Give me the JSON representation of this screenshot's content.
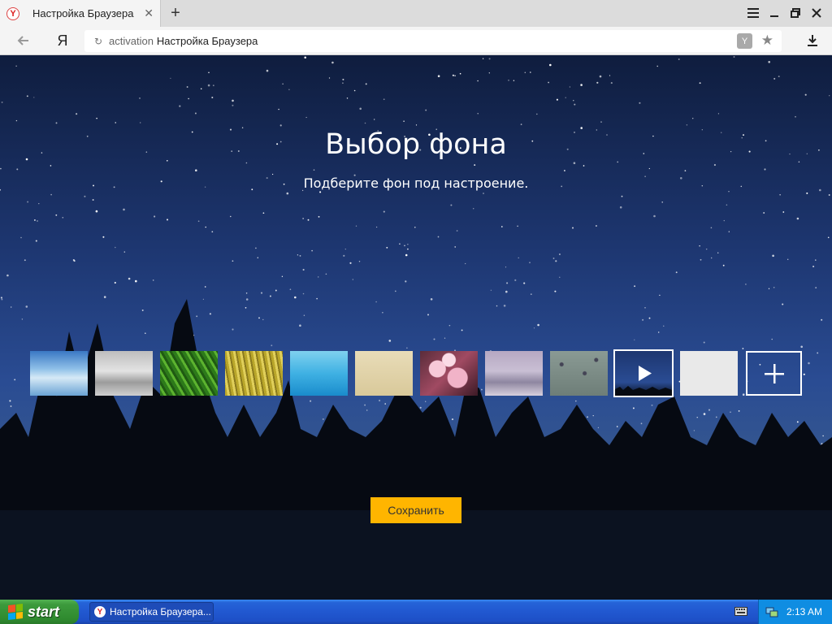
{
  "browser": {
    "tab": {
      "title": "Настройка Браузера",
      "favicon": "Y"
    },
    "address_bar": {
      "host": "activation",
      "title": "Настройка Браузера"
    },
    "yandex_button": "Я"
  },
  "page": {
    "title": "Выбор фона",
    "subtitle": "Подберите фон под настроение.",
    "thumbnails": [
      {
        "name": "sky-clouds",
        "selected": false
      },
      {
        "name": "fog",
        "selected": false
      },
      {
        "name": "green-grass",
        "selected": false
      },
      {
        "name": "yellow-field",
        "selected": false
      },
      {
        "name": "blue-sea",
        "selected": false
      },
      {
        "name": "sand",
        "selected": false
      },
      {
        "name": "cherry-blossom",
        "selected": false
      },
      {
        "name": "mountain",
        "selected": false
      },
      {
        "name": "rain-drops",
        "selected": false
      },
      {
        "name": "night-sky-video",
        "selected": true
      },
      {
        "name": "blank-light",
        "selected": false
      },
      {
        "name": "add-custom",
        "selected": false
      }
    ],
    "save_button": "Сохранить",
    "colors": {
      "save_button_bg": "#ffb500",
      "sky": "#1d3670"
    }
  },
  "taskbar": {
    "start_label": "start",
    "task_item": "Настройка Браузера...",
    "clock": "2:13 AM"
  }
}
